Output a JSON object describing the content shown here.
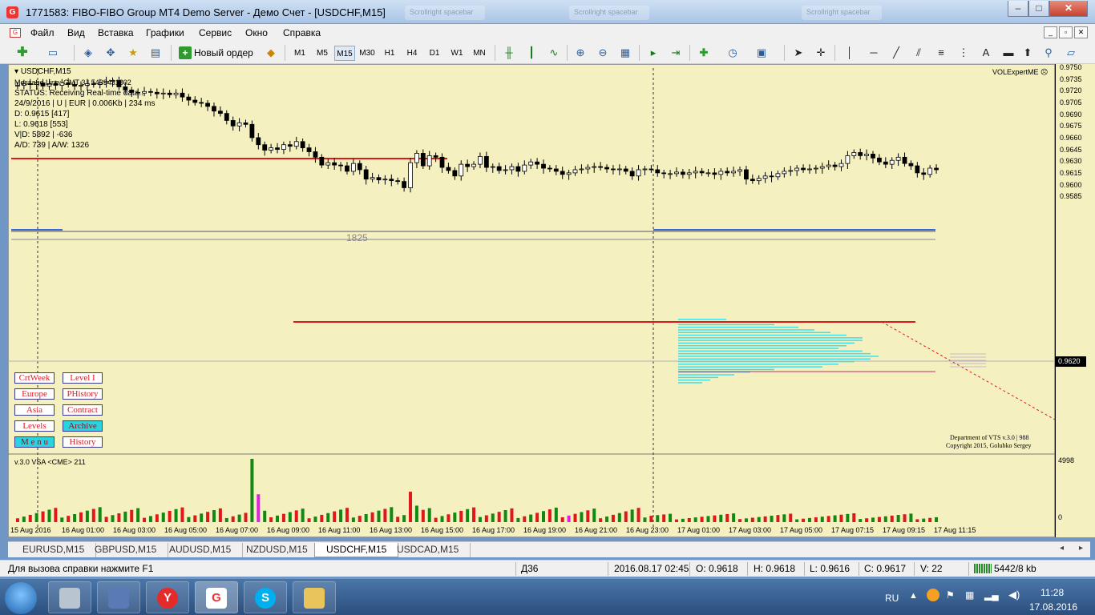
{
  "window": {
    "title": "1771583: FIBO-FIBO Group MT4 Demo Server - Демо Счет - [USDCHF,M15]",
    "icon_letter": "G",
    "ghost_tabs": [
      "Scrollright spacebar",
      "Scrollright spacebar",
      "Scrollright spacebar"
    ],
    "controls": {
      "minimize": "–",
      "maximize": "□",
      "close": "✕"
    }
  },
  "menu": {
    "items": [
      "Файл",
      "Вид",
      "Вставка",
      "Графики",
      "Сервис",
      "Окно",
      "Справка"
    ],
    "mdi_controls": [
      "_",
      "▫",
      "✕"
    ]
  },
  "toolbar": {
    "new_order_label": "Новый ордер",
    "timeframes": [
      "M1",
      "M5",
      "M15",
      "M30",
      "H1",
      "H4",
      "D1",
      "W1",
      "MN"
    ],
    "active_timeframe": "M15"
  },
  "chart": {
    "symbol_header": "USDCHF,M15",
    "info_lines": [
      "Message Line: GMT 3 | 5439431802",
      "STATUS:  Receiving Real-time data..",
      "24/9/2016 | U | EUR | 0.006Kb | 234 ms",
      "D: 0.9615 [417]",
      "L: 0.9618  [553]",
      "V|D: 5892 | -636",
      "A/D: 739 | A/W: 1326"
    ],
    "expert_label": "VOLExpertME",
    "expert_icon": "smiley-icon",
    "level_label": "1825",
    "buttons_left": [
      "CrtWeek",
      "Europe",
      "Asia",
      "Levels",
      "M e n u"
    ],
    "buttons_right": [
      "Level I",
      "PHistory",
      "Contract",
      "Archive",
      "History"
    ],
    "copyright_1": "Department of VTS  v.3.0 | 988",
    "copyright_2": "Copyright 2015, Golubko Sergey",
    "indicator_label": "v.3.0 VSA <CME> 211",
    "volume_max": "4998",
    "volume_zero": "0",
    "current_price": "0.9620",
    "price_ticks": [
      "0.9750",
      "0.9735",
      "0.9720",
      "0.9705",
      "0.9690",
      "0.9675",
      "0.9660",
      "0.9645",
      "0.9630",
      "0.9615",
      "0.9600",
      "0.9585"
    ],
    "time_ticks": [
      "15 Aug 2016",
      "16 Aug 01:00",
      "16 Aug 03:00",
      "16 Aug 05:00",
      "16 Aug 07:00",
      "16 Aug 09:00",
      "16 Aug 11:00",
      "16 Aug 13:00",
      "16 Aug 15:00",
      "16 Aug 17:00",
      "16 Aug 19:00",
      "16 Aug 21:00",
      "16 Aug 23:00",
      "17 Aug 01:00",
      "17 Aug 03:00",
      "17 Aug 05:00",
      "17 Aug 07:15",
      "17 Aug 09:15",
      "17 Aug 11:15"
    ],
    "colors": {
      "background": "#f5f0c0",
      "red_level": "#e01818",
      "blue_level": "#3a6bd4",
      "profile": "#3fe0ec",
      "volume_up": "#108a10",
      "volume_down": "#e01818",
      "volume_climax": "#e020e0"
    }
  },
  "tabs": {
    "items": [
      "EURUSD,M15",
      "GBPUSD,M15",
      "AUDUSD,M15",
      "NZDUSD,M15",
      "USDCHF,M15",
      "USDCAD,M15"
    ],
    "active": "USDCHF,M15"
  },
  "status": {
    "help_text": "Для вызова справки нажмите F1",
    "profile": "Д36",
    "datetime": "2016.08.17 02:45",
    "open": "O: 0.9618",
    "high": "H: 0.9618",
    "low": "L: 0.9616",
    "close": "C: 0.9617",
    "volume": "V: 22",
    "traffic": "5442/8 kb"
  },
  "taskbar": {
    "apps": [
      "calculator",
      "network-monitor",
      "yandex-browser",
      "fibo-group",
      "skype",
      "file-explorer"
    ],
    "app_letters": [
      "",
      "",
      "Y",
      "G",
      "S",
      ""
    ],
    "language": "RU",
    "time": "11:28",
    "date": "17.08.2016"
  }
}
